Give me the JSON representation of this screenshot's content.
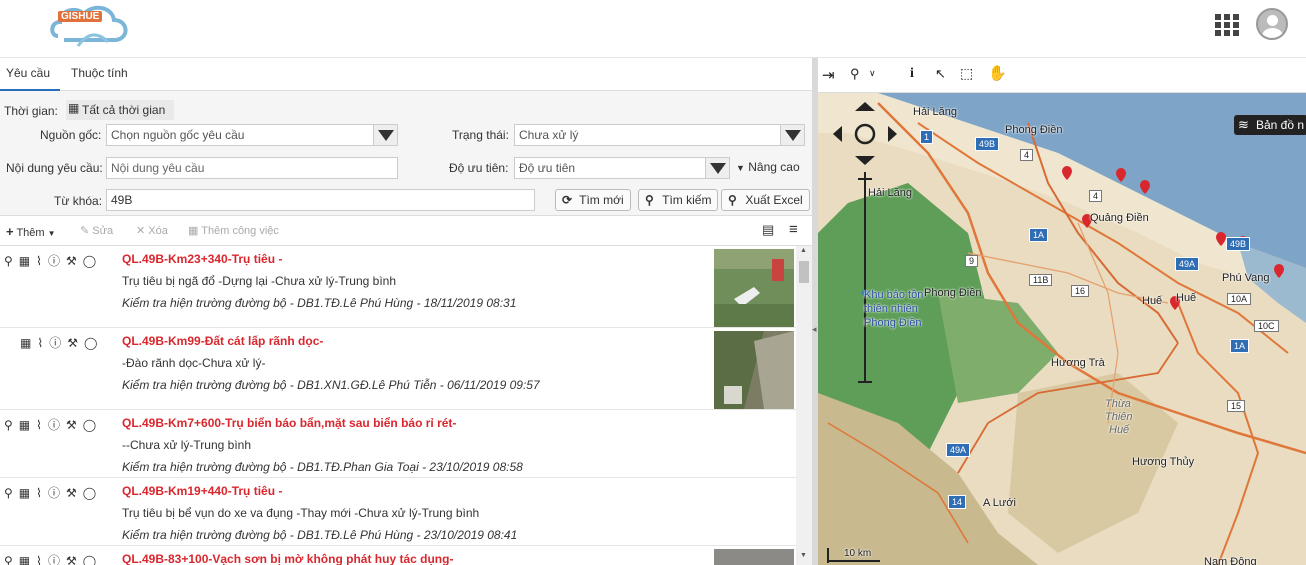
{
  "header": {
    "logo_text": "GISHUE"
  },
  "tabs": [
    {
      "label": "Yêu cầu",
      "active": true
    },
    {
      "label": "Thuộc tính",
      "active": false
    }
  ],
  "filters": {
    "time_label": "Thời gian:",
    "time_value": "Tất cả thời gian",
    "source_label": "Nguồn gốc:",
    "source_placeholder": "Chọn nguồn gốc yêu cầu",
    "status_label": "Trạng thái:",
    "status_value": "Chưa xử lý",
    "content_label": "Nội dung yêu cầu:",
    "content_placeholder": "Nội dung yêu cầu",
    "priority_label": "Độ ưu tiên:",
    "priority_placeholder": "Độ ưu tiên",
    "advanced_label": "Nâng cao",
    "keyword_label": "Từ khóa:",
    "keyword_value": "49B",
    "btn_new_search": "Tìm mới",
    "btn_search": "Tìm kiếm",
    "btn_export": "Xuất Excel"
  },
  "toolbar": {
    "add": "Thêm",
    "edit": "Sửa",
    "delete": "Xóa",
    "add_task": "Thêm công việc"
  },
  "items": [
    {
      "title": "QL.49B-Km23+340-Trụ tiêu -",
      "desc": "Trụ tiêu bị ngã đổ -Dựng lại -Chưa xử lý-Trung bình",
      "meta": "Kiểm tra hiện trường đường bộ - DB1.TĐ.Lê Phú Hùng - 18/11/2019 08:31"
    },
    {
      "title": "QL.49B-Km99-Đất cát lấp rãnh dọc-",
      "desc": "-Đào rãnh dọc-Chưa xử lý-",
      "meta": "Kiểm tra hiện trường đường bộ - DB1.XN1.GĐ.Lê Phú Tiễn - 06/11/2019 09:57"
    },
    {
      "title": "QL.49B-Km7+600-Trụ biển báo bẩn,mặt sau biển báo rỉ rét-",
      "desc": "--Chưa xử lý-Trung bình",
      "meta": "Kiểm tra hiện trường đường bộ - DB1.TĐ.Phan Gia Toại - 23/10/2019 08:58"
    },
    {
      "title": "QL.49B-Km19+440-Trụ tiêu -",
      "desc": "Trụ tiêu bị bể vụn do xe va đụng -Thay mới -Chưa xử lý-Trung bình",
      "meta": "Kiểm tra hiện trường đường bộ - DB1.TĐ.Lê Phú Hùng - 23/10/2019 08:41"
    },
    {
      "title": "QL.49B-83+100-Vạch sơn bị mờ không phát huy tác dụng-",
      "desc": "",
      "meta": ""
    }
  ],
  "map": {
    "basemap_label": "Bản đồ n",
    "scale_label": "10 km",
    "places": [
      "Hải Lăng",
      "Phong Điền",
      "Quảng Điền",
      "Hải Lăng",
      "Phong Điền",
      "Huế",
      "Huế",
      "Phú Vang",
      "Hương Trà",
      "Thừa",
      "Thiên",
      "Huế",
      "Hương Thủy",
      "A Lưới",
      "Nam Đông",
      "Khu bảo tồn",
      "thiên nhiên",
      "Phong Điền"
    ],
    "road_shields": [
      "1",
      "49B",
      "4",
      "4",
      "1A",
      "49B",
      "49A",
      "9",
      "11B",
      "16",
      "10A",
      "10C",
      "1A",
      "15",
      "49A",
      "14"
    ]
  },
  "colors": {
    "accent": "#2a6ebb",
    "title_red": "#d9272e",
    "sea": "#7ea4c7",
    "forest": "#4f9a4f"
  }
}
